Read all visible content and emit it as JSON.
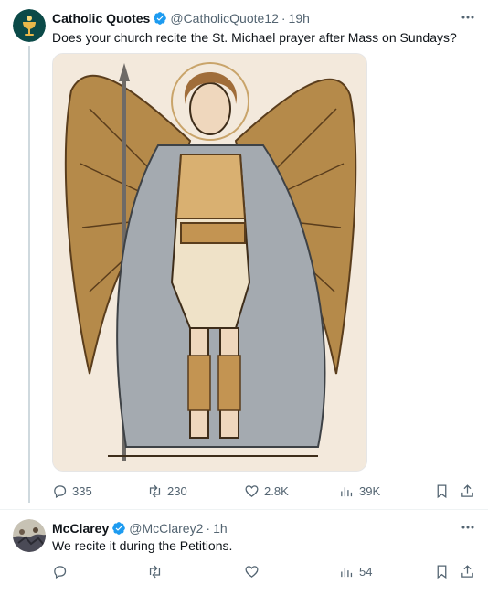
{
  "colors": {
    "text": "#0f1419",
    "muted": "#536471",
    "verified": "#1d9bf0",
    "divider": "#eff3f4"
  },
  "tweet": {
    "name": "Catholic Quotes",
    "handle": "@CatholicQuote12",
    "separator": "·",
    "time": "19h",
    "text": "Does your church recite the St. Michael prayer after Mass on Sundays?",
    "avatar_icon": "chalice-icon",
    "replies": "335",
    "reposts": "230",
    "likes": "2.8K",
    "views": "39K"
  },
  "reply": {
    "name": "McClarey",
    "handle": "@McClarey2",
    "separator": "·",
    "time": "1h",
    "text": "We recite it during the Petitions.",
    "views": "54"
  }
}
